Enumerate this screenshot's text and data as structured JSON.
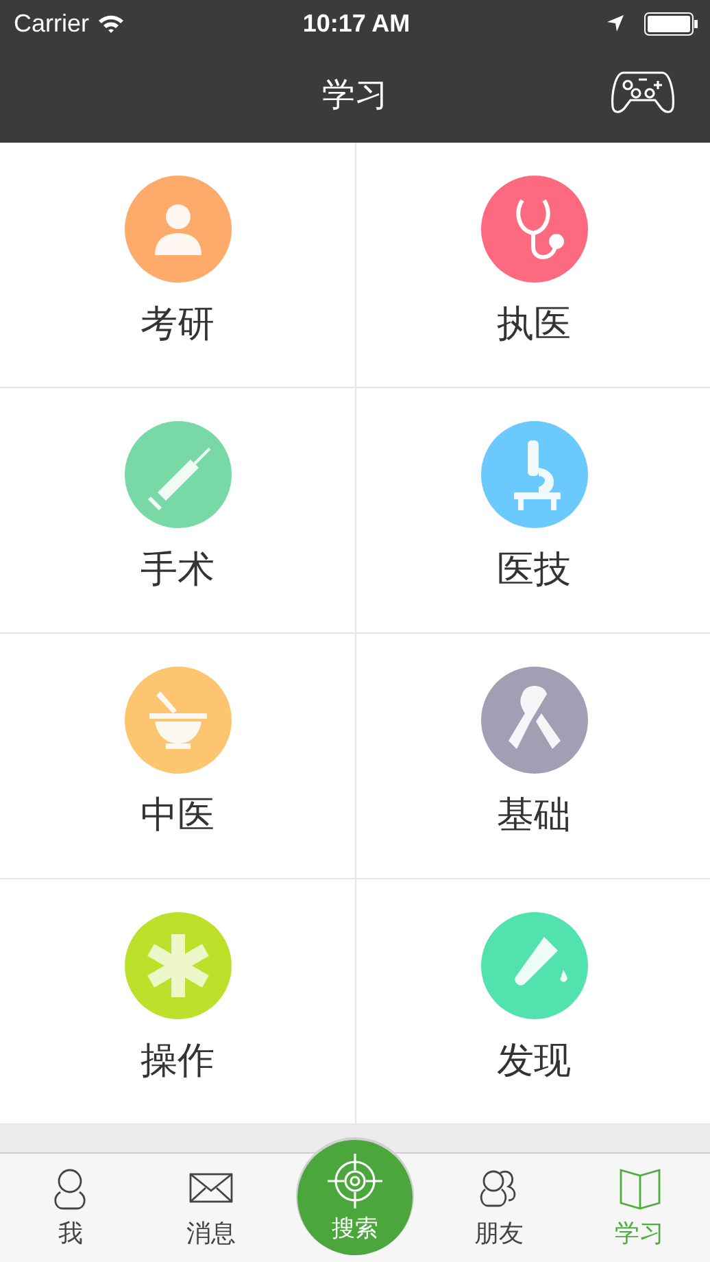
{
  "status_bar": {
    "carrier": "Carrier",
    "time": "10:17 AM"
  },
  "nav_bar": {
    "title": "学习"
  },
  "tiles": [
    {
      "label": "考研",
      "kind": "doctor",
      "color": "#fdaa6a"
    },
    {
      "label": "执医",
      "kind": "stethoscope",
      "color": "#fd6a80"
    },
    {
      "label": "手术",
      "kind": "syringe",
      "color": "#78d8a6"
    },
    {
      "label": "医技",
      "kind": "microscope",
      "color": "#6ac9fd"
    },
    {
      "label": "中医",
      "kind": "mortar",
      "color": "#fdc56f"
    },
    {
      "label": "基础",
      "kind": "ribbon",
      "color": "#a29fb5"
    },
    {
      "label": "操作",
      "kind": "star",
      "color": "#bde02a"
    },
    {
      "label": "发现",
      "kind": "tube",
      "color": "#52e2ae"
    }
  ],
  "tab_bar": [
    {
      "label": "我",
      "kind": "person",
      "selected": false
    },
    {
      "label": "消息",
      "kind": "mail",
      "selected": false
    },
    {
      "label": "搜索",
      "kind": "center",
      "selected": false
    },
    {
      "label": "朋友",
      "kind": "friends",
      "selected": false
    },
    {
      "label": "学习",
      "kind": "book",
      "selected": true
    }
  ]
}
